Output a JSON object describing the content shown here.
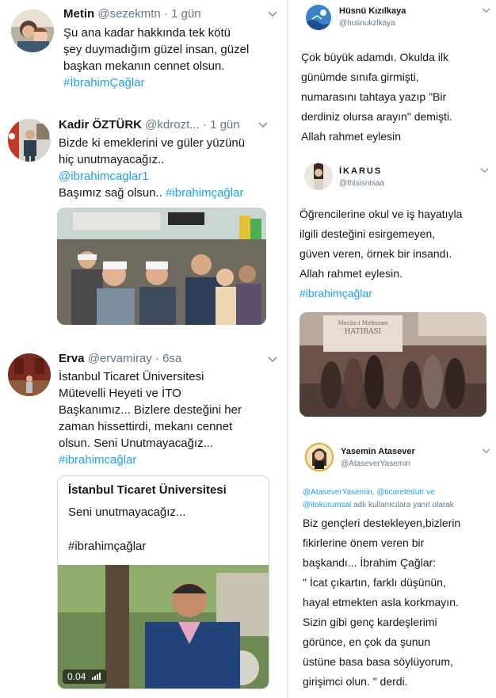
{
  "left_column": {
    "tweets": [
      {
        "name": "Metin",
        "handle": "@sezekmtn",
        "time": "· 1 gün",
        "lines": [
          "Şu ana kadar hakkında tek kötü",
          "şey duymadığım güzel insan, güzel",
          "başkan mekanın cennet olsun."
        ],
        "hashtag": "#İbrahimÇağlar"
      },
      {
        "name": "Kadir ÖZTÜRK",
        "handle": "@kdrozt...",
        "time": "· 1 gün",
        "lines": [
          "Bizde ki emeklerini ve güler yüzünü",
          "hiç unutmayacağız.."
        ],
        "mention": "@ibrahimcaglar1",
        "last_line_prefix": "Başımız sağ olsun.. ",
        "hashtag": "#ibrahimçağlar"
      },
      {
        "name": "Erva",
        "handle": "@ervamiray",
        "time": "· 6sa",
        "lines": [
          "İstanbul Ticaret Üniversitesi",
          "Mütevelli Heyeti ve İTO",
          "Başkanımız... Bizlere desteğini her",
          "zaman hissettirdi, mekanı cennet",
          "olsun. Seni Unutmayacağız..."
        ],
        "hashtag": "#ibrahimcağlar",
        "card": {
          "title": "İstanbul Ticaret Üniversitesi",
          "line1": "Seni unutmayacağız...",
          "line2": "#ibrahimçağlar",
          "video_time": "0.04"
        }
      }
    ]
  },
  "right_column": {
    "tweets": [
      {
        "name": "Hüsnü Kızılkaya",
        "handle": "@husnukzlkaya",
        "lines": [
          "Çok büyük adamdı. Okulda ilk",
          "günümde sınıfa girmişti,",
          "numarasını tahtaya yazıp \"Bir",
          "derdiniz olursa arayın\" demişti.",
          "Allah rahmet eylesin"
        ]
      },
      {
        "name": "İKARUS",
        "handle": "@thisisnisaa",
        "lines": [
          "Öğrencilerine okul ve iş hayatıyla",
          "ilgili desteğini esirgemeyen,",
          "güven veren, örnek bir insandı.",
          "Allah rahmet eylesin."
        ],
        "hashtag": "#ibrahimçağlar",
        "photo_sign_line1": "Meclis-i Mebusan",
        "photo_sign_line2": "HATIRASI"
      },
      {
        "name": "Yasemin Atasever",
        "handle": "@AtaseverYasemin",
        "reply_line1": "@AtaseverYasemin, @ticaretedutr ve",
        "reply_line2_link": "@itokurumsal",
        "reply_line2_rest": " adlı kullanıcılara yanıt olarak",
        "lines": [
          "Biz gençleri destekleyen,bizlerin",
          "fikirlerine önem veren bir",
          "başkandı... İbrahim Çağlar:",
          "\" İcat çıkartın, farklı düşünün,",
          "hayal etmekten asla korkmayın.",
          "Sizin gibi genç kardeşlerimi",
          "görünce, en çok da şunun",
          "üstüne basa basa söylüyorum,",
          "girişimci olun. \" derdi."
        ]
      }
    ]
  },
  "colors": {
    "link": "#1da1f2",
    "secondary_text": "#657786",
    "primary_text": "#14171a"
  }
}
